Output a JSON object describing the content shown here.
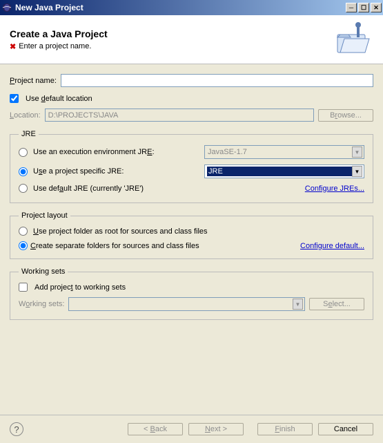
{
  "titlebar": {
    "title": "New Java Project"
  },
  "header": {
    "title": "Create a Java Project",
    "subtitle": "Enter a project name."
  },
  "projectName": {
    "label": "Project name:",
    "value": ""
  },
  "useDefaultLocation": {
    "label": "Use default location",
    "checked": true
  },
  "location": {
    "label": "Location:",
    "value": "D:\\PROJECTS\\JAVA",
    "browse": "Browse..."
  },
  "jre": {
    "legend": "JRE",
    "execEnv": {
      "label": "Use an execution environment JRE:",
      "value": "JavaSE-1.7"
    },
    "projectSpecific": {
      "label": "Use a project specific JRE:",
      "value": "JRE"
    },
    "defaultJre": {
      "label": "Use default JRE (currently 'JRE')"
    },
    "configure": "Configure JREs..."
  },
  "layout": {
    "legend": "Project layout",
    "rootFolder": "Use project folder as root for sources and class files",
    "separateFolders": "Create separate folders for sources and class files",
    "configure": "Configure default..."
  },
  "workingSets": {
    "legend": "Working sets",
    "add": "Add project to working sets",
    "label": "Working sets:",
    "value": "",
    "select": "Select..."
  },
  "buttons": {
    "back": "< Back",
    "next": "Next >",
    "finish": "Finish",
    "cancel": "Cancel"
  }
}
